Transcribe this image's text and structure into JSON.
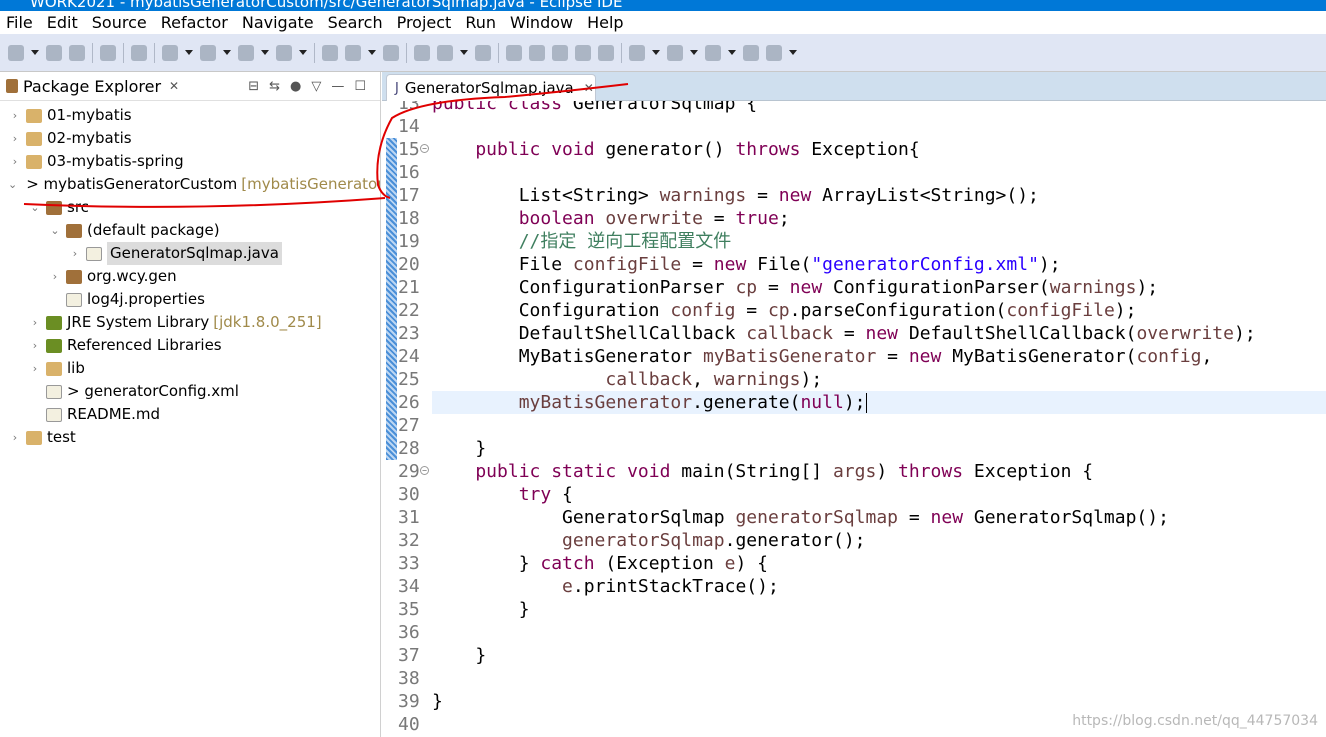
{
  "window": {
    "title": "WORK2021 - mybatisGeneratorCustom/src/GeneratorSqlmap.java - Eclipse IDE"
  },
  "menu": [
    "File",
    "Edit",
    "Source",
    "Refactor",
    "Navigate",
    "Search",
    "Project",
    "Run",
    "Window",
    "Help"
  ],
  "toolbar_icons": [
    "new-icon",
    "save-icon",
    "save-all-icon",
    "terminal-icon",
    "skip-breakpoints-icon",
    "debug-icon",
    "run-icon",
    "coverage-icon",
    "external-tools-icon",
    "new-java-package-icon",
    "new-java-class-icon",
    "open-type-icon",
    "open-task-icon",
    "search-icon",
    "next-annotation-icon",
    "mark-occurrences-icon",
    "block-selection-icon",
    "toggle-editor-icon",
    "show-whitespace-icon",
    "pilcrow-icon",
    "next-edit-icon",
    "prev-edit-icon",
    "last-edit-icon",
    "back-icon",
    "forward-icon"
  ],
  "explorer": {
    "title": "Package Explorer",
    "tree": [
      {
        "label": "01-mybatis",
        "depth": 0,
        "twisty": ">",
        "icon": "project"
      },
      {
        "label": "02-mybatis",
        "depth": 0,
        "twisty": ">",
        "icon": "project"
      },
      {
        "label": "03-mybatis-spring",
        "depth": 0,
        "twisty": ">",
        "icon": "project"
      },
      {
        "label": "> mybatisGeneratorCustom",
        "deco": "[mybatisGeneratorCustom]",
        "depth": 0,
        "twisty": "v",
        "icon": "project"
      },
      {
        "label": "src",
        "depth": 1,
        "twisty": "v",
        "icon": "pkg"
      },
      {
        "label": "(default package)",
        "depth": 2,
        "twisty": "v",
        "icon": "pkg"
      },
      {
        "label": "GeneratorSqlmap.java",
        "depth": 3,
        "twisty": ">",
        "icon": "file",
        "selected": true
      },
      {
        "label": "org.wcy.gen",
        "depth": 2,
        "twisty": ">",
        "icon": "pkg"
      },
      {
        "label": "log4j.properties",
        "depth": 2,
        "twisty": "",
        "icon": "file"
      },
      {
        "label": "JRE System Library",
        "deco": "[jdk1.8.0_251]",
        "depth": 1,
        "twisty": ">",
        "icon": "lib"
      },
      {
        "label": "Referenced Libraries",
        "depth": 1,
        "twisty": ">",
        "icon": "lib"
      },
      {
        "label": "lib",
        "depth": 1,
        "twisty": ">",
        "icon": "project"
      },
      {
        "label": "> generatorConfig.xml",
        "depth": 1,
        "twisty": "",
        "icon": "file"
      },
      {
        "label": "README.md",
        "depth": 1,
        "twisty": "",
        "icon": "file"
      },
      {
        "label": "test",
        "depth": 0,
        "twisty": ">",
        "icon": "project"
      }
    ]
  },
  "editor": {
    "tab": "GeneratorSqlmap.java",
    "current_line": 26,
    "lines": [
      {
        "n": "13",
        "t": [
          [
            "public class ",
            "k"
          ],
          [
            "GeneratorSqlmap {",
            ""
          ]
        ]
      },
      {
        "n": "14",
        "t": []
      },
      {
        "n": "15",
        "fold": true,
        "t": [
          [
            "    public void ",
            "k"
          ],
          [
            "generator() ",
            ""
          ],
          [
            "throws ",
            "k"
          ],
          [
            "Exception{",
            ""
          ]
        ]
      },
      {
        "n": "16",
        "t": []
      },
      {
        "n": "17",
        "t": [
          [
            "        List<String> ",
            ""
          ],
          [
            "warnings",
            "v"
          ],
          [
            " = ",
            ""
          ],
          [
            "new ",
            "k"
          ],
          [
            "ArrayList<String>();",
            ""
          ]
        ]
      },
      {
        "n": "18",
        "t": [
          [
            "        boolean ",
            "k"
          ],
          [
            "overwrite",
            "v"
          ],
          [
            " = ",
            ""
          ],
          [
            "true",
            "k"
          ],
          [
            ";",
            ""
          ]
        ]
      },
      {
        "n": "19",
        "t": [
          [
            "        //指定 逆向工程配置文件",
            "c"
          ]
        ]
      },
      {
        "n": "20",
        "t": [
          [
            "        File ",
            ""
          ],
          [
            "configFile",
            "v"
          ],
          [
            " = ",
            ""
          ],
          [
            "new ",
            "k"
          ],
          [
            "File(",
            ""
          ],
          [
            "\"generatorConfig.xml\"",
            "s"
          ],
          [
            ");",
            ""
          ]
        ]
      },
      {
        "n": "21",
        "t": [
          [
            "        ConfigurationParser ",
            ""
          ],
          [
            "cp",
            "v"
          ],
          [
            " = ",
            ""
          ],
          [
            "new ",
            "k"
          ],
          [
            "ConfigurationParser(",
            ""
          ],
          [
            "warnings",
            "v"
          ],
          [
            ");",
            ""
          ]
        ]
      },
      {
        "n": "22",
        "t": [
          [
            "        Configuration ",
            ""
          ],
          [
            "config",
            "v"
          ],
          [
            " = ",
            ""
          ],
          [
            "cp",
            "v"
          ],
          [
            ".parseConfiguration(",
            ""
          ],
          [
            "configFile",
            "v"
          ],
          [
            ");",
            ""
          ]
        ]
      },
      {
        "n": "23",
        "t": [
          [
            "        DefaultShellCallback ",
            ""
          ],
          [
            "callback",
            "v"
          ],
          [
            " = ",
            ""
          ],
          [
            "new ",
            "k"
          ],
          [
            "DefaultShellCallback(",
            ""
          ],
          [
            "overwrite",
            "v"
          ],
          [
            ");",
            ""
          ]
        ]
      },
      {
        "n": "24",
        "t": [
          [
            "        MyBatisGenerator ",
            ""
          ],
          [
            "myBatisGenerator",
            "v"
          ],
          [
            " = ",
            ""
          ],
          [
            "new ",
            "k"
          ],
          [
            "MyBatisGenerator(",
            ""
          ],
          [
            "config",
            "v"
          ],
          [
            ",",
            ""
          ]
        ]
      },
      {
        "n": "25",
        "t": [
          [
            "                ",
            ""
          ],
          [
            "callback",
            "v"
          ],
          [
            ", ",
            ""
          ],
          [
            "warnings",
            "v"
          ],
          [
            ");",
            ""
          ]
        ]
      },
      {
        "n": "26",
        "t": [
          [
            "        ",
            ""
          ],
          [
            "myBatisGenerator",
            "v"
          ],
          [
            ".generate(",
            ""
          ],
          [
            "null",
            "k"
          ],
          [
            ");",
            ""
          ]
        ]
      },
      {
        "n": "27",
        "t": []
      },
      {
        "n": "28",
        "t": [
          [
            "    }",
            ""
          ]
        ]
      },
      {
        "n": "29",
        "fold": true,
        "t": [
          [
            "    public static void ",
            "k"
          ],
          [
            "main(String[] ",
            ""
          ],
          [
            "args",
            "v"
          ],
          [
            ") ",
            ""
          ],
          [
            "throws ",
            "k"
          ],
          [
            "Exception {",
            ""
          ]
        ]
      },
      {
        "n": "30",
        "t": [
          [
            "        try ",
            "k"
          ],
          [
            "{",
            ""
          ]
        ]
      },
      {
        "n": "31",
        "t": [
          [
            "            GeneratorSqlmap ",
            ""
          ],
          [
            "generatorSqlmap",
            "v"
          ],
          [
            " = ",
            ""
          ],
          [
            "new ",
            "k"
          ],
          [
            "GeneratorSqlmap();",
            ""
          ]
        ]
      },
      {
        "n": "32",
        "t": [
          [
            "            ",
            ""
          ],
          [
            "generatorSqlmap",
            "v"
          ],
          [
            ".generator();",
            ""
          ]
        ]
      },
      {
        "n": "33",
        "t": [
          [
            "        } ",
            ""
          ],
          [
            "catch ",
            "k"
          ],
          [
            "(Exception ",
            ""
          ],
          [
            "e",
            "v"
          ],
          [
            ") {",
            ""
          ]
        ]
      },
      {
        "n": "34",
        "t": [
          [
            "            ",
            ""
          ],
          [
            "e",
            "v"
          ],
          [
            ".printStackTrace();",
            ""
          ]
        ]
      },
      {
        "n": "35",
        "t": [
          [
            "        }",
            ""
          ]
        ]
      },
      {
        "n": "36",
        "t": []
      },
      {
        "n": "37",
        "t": [
          [
            "    }",
            ""
          ]
        ]
      },
      {
        "n": "38",
        "t": []
      },
      {
        "n": "39",
        "t": [
          [
            "}",
            ""
          ]
        ]
      },
      {
        "n": "40",
        "t": []
      }
    ]
  },
  "watermark": "https://blog.csdn.net/qq_44757034",
  "colors": {
    "keyword": "#7f0055",
    "variable": "#6a3e3e",
    "string": "#2a00ff",
    "comment": "#3f7f5f",
    "titlebar": "#0078d7",
    "annotation": "#e00000"
  }
}
